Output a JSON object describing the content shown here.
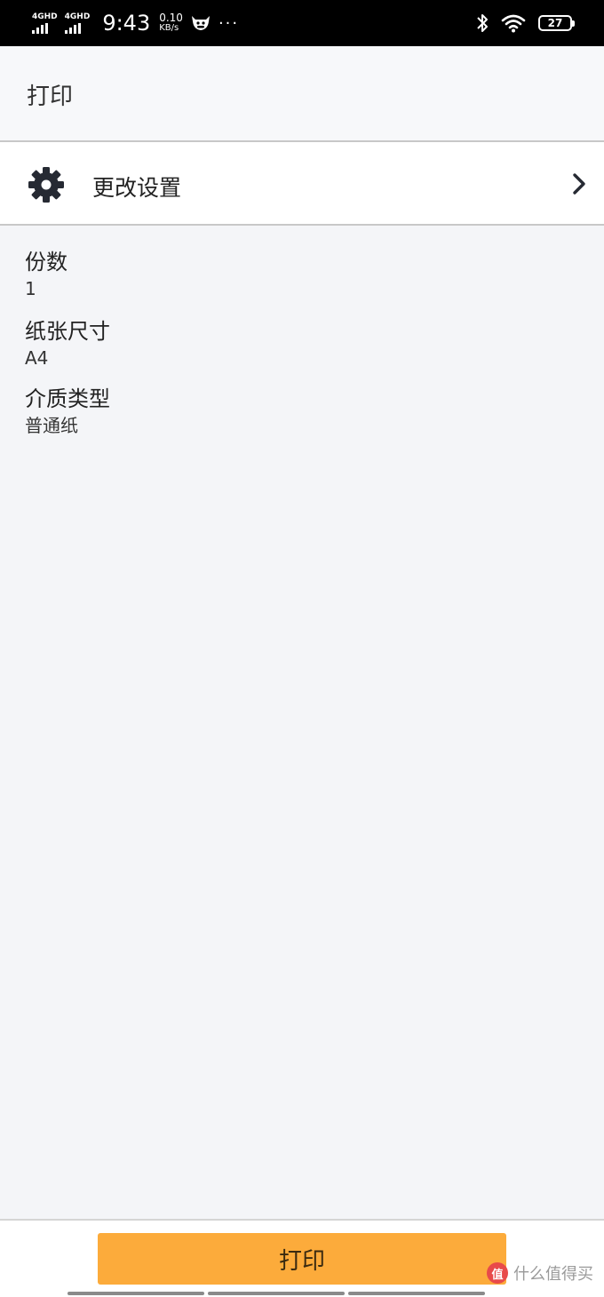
{
  "status_bar": {
    "signal1": "4GHD",
    "signal2": "4GHD",
    "time": "9:43",
    "speed_value": "0.10",
    "speed_unit": "KB/s",
    "more": "···",
    "battery": "27"
  },
  "header": {
    "title": "打印"
  },
  "settings_row": {
    "label": "更改设置"
  },
  "info": [
    {
      "label": "份数",
      "value": "1"
    },
    {
      "label": "纸张尺寸",
      "value": "A4"
    },
    {
      "label": "介质类型",
      "value": "普通纸"
    }
  ],
  "bottom": {
    "print_label": "打印",
    "watermark": "什么值得买",
    "watermark_logo": "值"
  },
  "colors": {
    "accent": "#fcab3b",
    "background": "#f4f5f8"
  }
}
